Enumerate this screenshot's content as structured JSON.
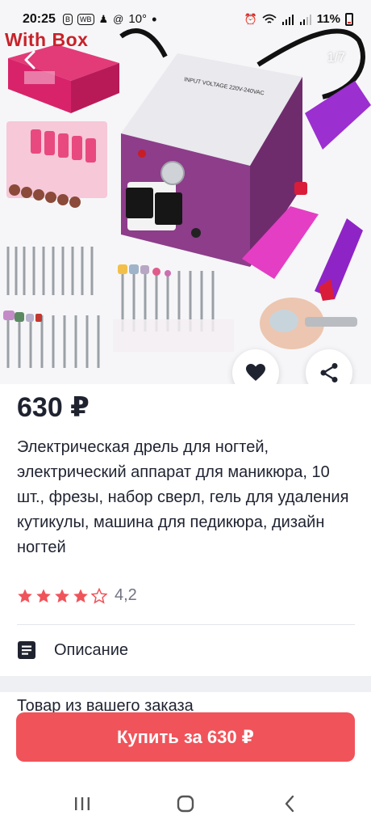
{
  "status_bar": {
    "time": "20:25",
    "badge_b": "B",
    "badge_wb": "WB",
    "temperature": "10°",
    "battery": "11%"
  },
  "gallery": {
    "overlay_text": "With Box",
    "counter": "1/7",
    "icons": [
      "back-arrow-icon",
      "heart-icon",
      "share-icon"
    ]
  },
  "product": {
    "price": "630 ₽",
    "title": "Электрическая дрель для ногтей, электрический аппарат для маникюра, 10 шт., фрезы, набор сверл, гель для удаления кутикулы, машина для педикюра, дизайн ногтей",
    "rating": 4.2,
    "rating_text": "4,2",
    "stars_filled": 4,
    "stars_total": 5
  },
  "description": {
    "label": "Описание",
    "icon": "document-icon"
  },
  "order_hint": "Товар из вашего заказа",
  "buy_button": {
    "label": "Купить за 630 ₽",
    "color": "#f0535a"
  },
  "colors": {
    "star": "#f0535a",
    "text": "#1f2330",
    "muted": "#707482"
  },
  "nav": [
    "recent-apps-icon",
    "home-icon",
    "back-icon"
  ]
}
